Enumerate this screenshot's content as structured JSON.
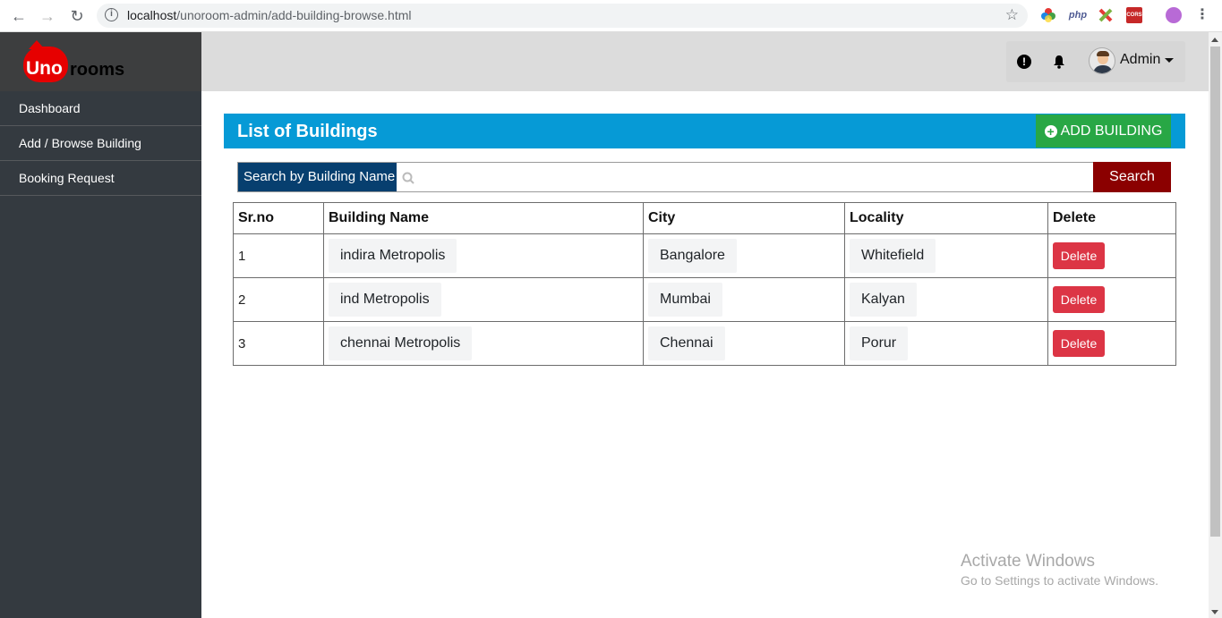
{
  "browser": {
    "url_host": "localhost",
    "url_path": "/unoroom-admin/add-building-browse.html",
    "extension_php_label": "php",
    "extension_cors_label": "CORS"
  },
  "brand": {
    "uno": "Uno",
    "rooms": "rooms",
    "accent": "#e60000"
  },
  "sidebar": {
    "items": [
      {
        "label": "Dashboard"
      },
      {
        "label": "Add / Browse Building"
      },
      {
        "label": "Booking Request"
      }
    ]
  },
  "topbar": {
    "user_name": "Admin",
    "alert_icon": "exclamation-circle-icon",
    "bell_icon": "bell-icon"
  },
  "panel": {
    "title": "List of Buildings",
    "add_button": "ADD BUILDING",
    "header_color": "#069ad6"
  },
  "search": {
    "label": "Search by Building Name",
    "placeholder": "",
    "value": "",
    "button": "Search"
  },
  "table": {
    "columns": [
      "Sr.no",
      "Building Name",
      "City",
      "Locality",
      "Delete"
    ],
    "rows": [
      {
        "srno": "1",
        "building": "indira Metropolis",
        "city": "Bangalore",
        "locality": "Whitefield",
        "delete": "Delete"
      },
      {
        "srno": "2",
        "building": "ind Metropolis",
        "city": "Mumbai",
        "locality": "Kalyan",
        "delete": "Delete"
      },
      {
        "srno": "3",
        "building": "chennai Metropolis",
        "city": "Chennai",
        "locality": "Porur",
        "delete": "Delete"
      }
    ]
  },
  "watermark": {
    "line1": "Activate Windows",
    "line2": "Go to Settings to activate Windows."
  }
}
